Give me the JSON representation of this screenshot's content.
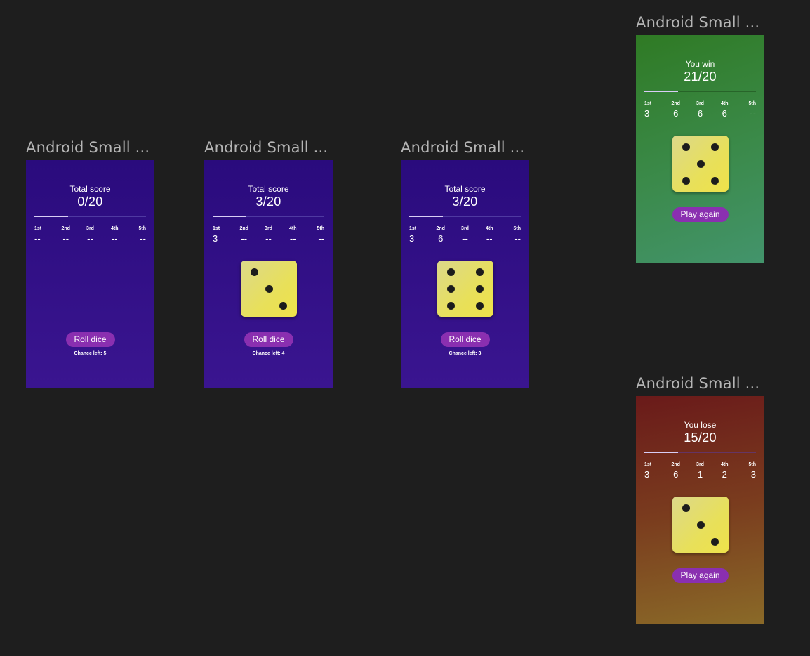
{
  "frames": [
    {
      "label": "Android Small ...",
      "status": "Total score",
      "score": "0/20",
      "progress": 0.3,
      "turns": [
        {
          "label": "1st",
          "value": "--"
        },
        {
          "label": "2nd",
          "value": "--"
        },
        {
          "label": "3rd",
          "value": "--"
        },
        {
          "label": "4th",
          "value": "--"
        },
        {
          "label": "5th",
          "value": "--"
        }
      ],
      "die": null,
      "button": "Roll dice",
      "chances": "Chance left: 5"
    },
    {
      "label": "Android Small ...",
      "status": "Total score",
      "score": "3/20",
      "progress": 0.3,
      "turns": [
        {
          "label": "1st",
          "value": "3"
        },
        {
          "label": "2nd",
          "value": "--"
        },
        {
          "label": "3rd",
          "value": "--"
        },
        {
          "label": "4th",
          "value": "--"
        },
        {
          "label": "5th",
          "value": "--"
        }
      ],
      "die": 3,
      "button": "Roll dice",
      "chances": "Chance left: 4"
    },
    {
      "label": "Android Small ...",
      "status": "Total score",
      "score": "3/20",
      "progress": 0.3,
      "turns": [
        {
          "label": "1st",
          "value": "3"
        },
        {
          "label": "2nd",
          "value": "6"
        },
        {
          "label": "3rd",
          "value": "--"
        },
        {
          "label": "4th",
          "value": "--"
        },
        {
          "label": "5th",
          "value": "--"
        }
      ],
      "die": 6,
      "button": "Roll dice",
      "chances": "Chance left: 3"
    },
    {
      "label": "Android Small ...",
      "status": "You win",
      "score": "21/20",
      "progress": 0.3,
      "turns": [
        {
          "label": "1st",
          "value": "3"
        },
        {
          "label": "2nd",
          "value": "6"
        },
        {
          "label": "3rd",
          "value": "6"
        },
        {
          "label": "4th",
          "value": "6"
        },
        {
          "label": "5th",
          "value": "--"
        }
      ],
      "die": 5,
      "button": "Play again",
      "chances": ""
    },
    {
      "label": "Android Small ...",
      "status": "You lose",
      "score": "15/20",
      "progress": 0.3,
      "turns": [
        {
          "label": "1st",
          "value": "3"
        },
        {
          "label": "2nd",
          "value": "6"
        },
        {
          "label": "3rd",
          "value": "1"
        },
        {
          "label": "4th",
          "value": "2"
        },
        {
          "label": "5th",
          "value": "3"
        }
      ],
      "die": 3,
      "button": "Play again",
      "chances": ""
    }
  ],
  "colors": {
    "canvas": "#1e1e1e",
    "button": "#8a2fb0",
    "die_face": "#e8e05a",
    "pip": "#1c1c1c"
  }
}
